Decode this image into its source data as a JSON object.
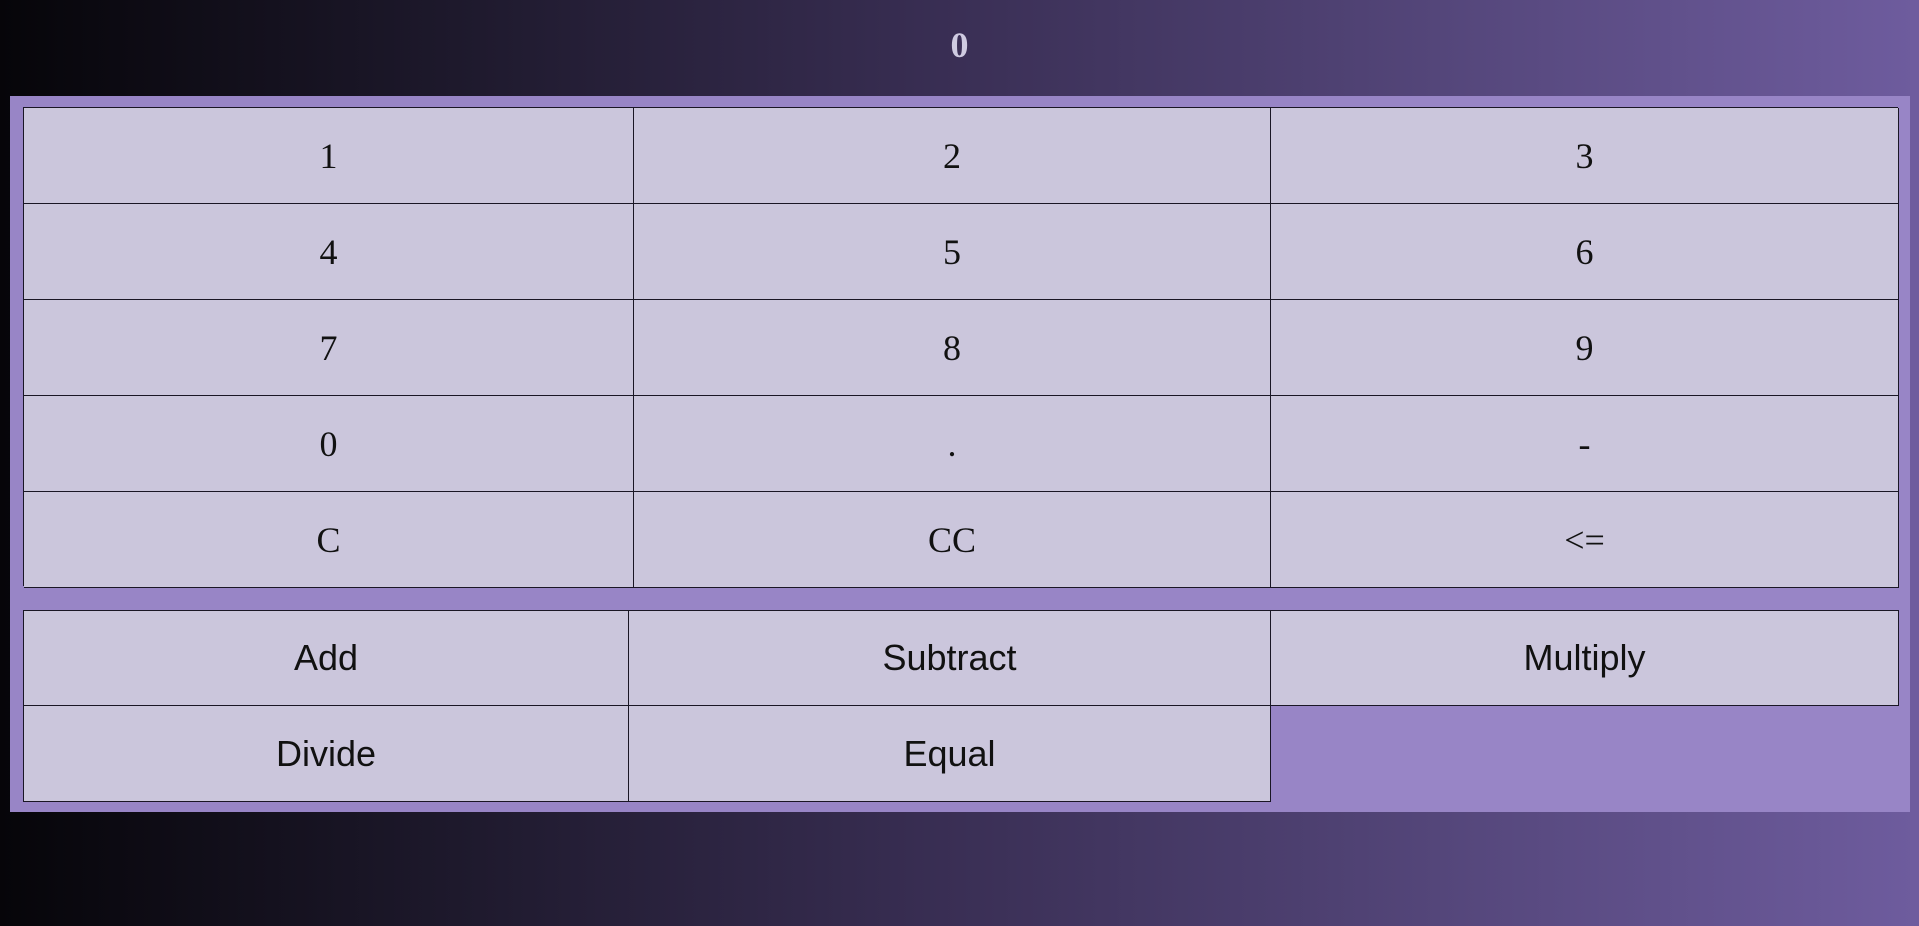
{
  "display": {
    "value": "0"
  },
  "keypad": {
    "keys": [
      "1",
      "2",
      "3",
      "4",
      "5",
      "6",
      "7",
      "8",
      "9",
      "0",
      ".",
      "-",
      "C",
      "CC",
      "<="
    ]
  },
  "operations": {
    "add": "Add",
    "subtract": "Subtract",
    "multiply": "Multiply",
    "divide": "Divide",
    "equal": "Equal"
  },
  "colors": {
    "panel": "#9885c6",
    "key": "#cbc6dc",
    "display_text": "#cfcbe1"
  }
}
